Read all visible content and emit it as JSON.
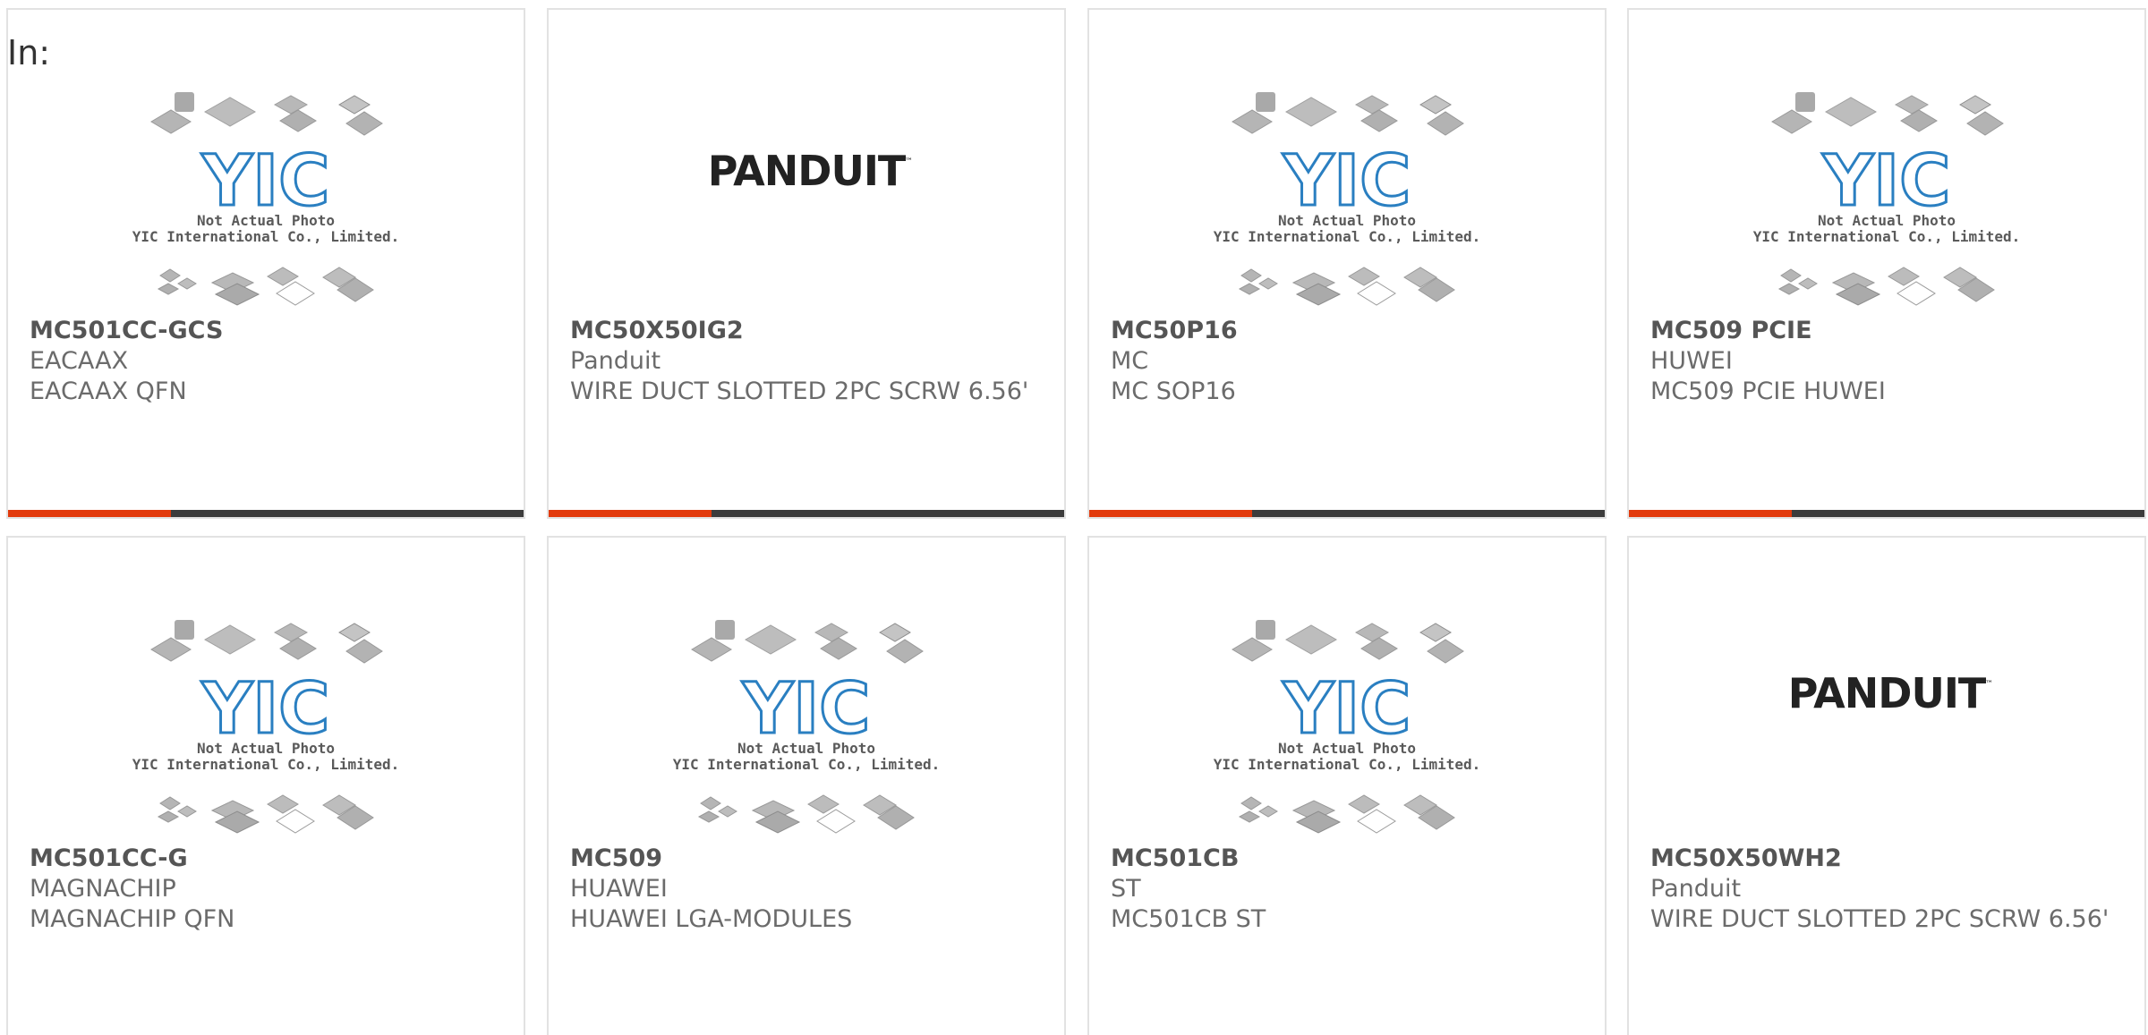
{
  "heading": "In:",
  "placeholder": {
    "line1": "Not Actual Photo",
    "line2": "YIC International Co., Limited."
  },
  "panduit_logo_text": "PANDUIT",
  "colors": {
    "accent": "#e23a0c",
    "bar": "#3c3c3c",
    "yic_blue": "#2a7fc1",
    "card_border": "#e2e2e2"
  },
  "products": [
    {
      "part": "MC501CC-GCS",
      "manufacturer": "EACAAX",
      "description": "EACAAX QFN",
      "image": "yic-placeholder"
    },
    {
      "part": "MC50X50IG2",
      "manufacturer": "Panduit",
      "description": "WIRE DUCT SLOTTED 2PC SCRW 6.56'",
      "image": "panduit-logo"
    },
    {
      "part": "MC50P16",
      "manufacturer": "MC",
      "description": "MC SOP16",
      "image": "yic-placeholder"
    },
    {
      "part": "MC509 PCIE",
      "manufacturer": "HUWEI",
      "description": "MC509 PCIE HUWEI",
      "image": "yic-placeholder"
    },
    {
      "part": "MC501CC-G",
      "manufacturer": "MAGNACHIP",
      "description": "MAGNACHIP QFN",
      "image": "yic-placeholder"
    },
    {
      "part": "MC509",
      "manufacturer": "HUAWEI",
      "description": "HUAWEI LGA-MODULES",
      "image": "yic-placeholder"
    },
    {
      "part": "MC501CB",
      "manufacturer": "ST",
      "description": "MC501CB ST",
      "image": "yic-placeholder"
    },
    {
      "part": "MC50X50WH2",
      "manufacturer": "Panduit",
      "description": "WIRE DUCT SLOTTED 2PC SCRW 6.56'",
      "image": "panduit-logo"
    }
  ]
}
